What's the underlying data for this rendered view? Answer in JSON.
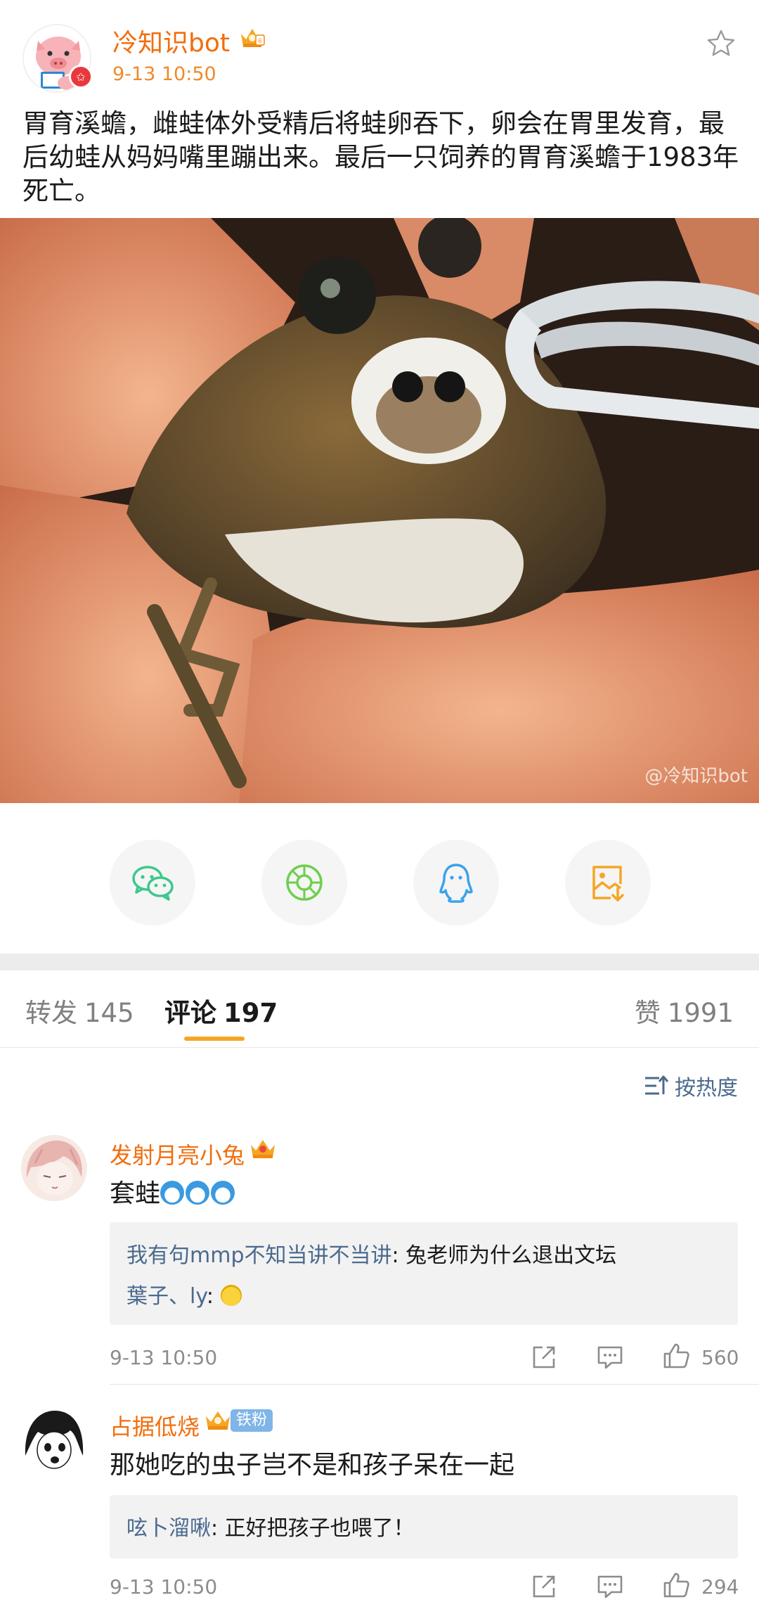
{
  "post": {
    "author": "冷知识bot",
    "time": "9-13 10:50",
    "text": "胃育溪蟾，雌蛙体外受精后将蛙卵吞下，卵会在胃里发育，最后幼蛙从妈妈嘴里蹦出来。最后一只饲养的胃育溪蟾于1983年死亡。",
    "photo_watermark": "@冷知识bot"
  },
  "share": [
    "wechat-icon",
    "moments-icon",
    "qq-icon",
    "save-image-icon"
  ],
  "tabs": {
    "repost_label": "转发",
    "repost_count": "145",
    "comment_label": "评论",
    "comment_count": "197",
    "like_label": "赞",
    "like_count": "1991"
  },
  "sort_label": "按热度",
  "comments": [
    {
      "name": "发射月亮小兔",
      "text": "套蛙",
      "emoji_count": 3,
      "replies": [
        {
          "user": "我有句mmp不知当讲不当讲",
          "text": ": 兔老师为什么退出文坛"
        },
        {
          "user": "葉子、ly",
          "text": ": "
        }
      ],
      "time": "9-13 10:50",
      "likes": "560"
    },
    {
      "name": "占据低烧",
      "fan_badge": "铁粉",
      "text": "那她吃的虫子岂不是和孩子呆在一起",
      "replies": [
        {
          "user": "呟卜溜啾",
          "text": ": 正好把孩子也喂了！"
        }
      ],
      "time": "9-13 10:50",
      "likes": "294"
    }
  ],
  "colors": {
    "orange": "#f26d0c",
    "link_blue": "#4b6a8e",
    "tab_underline": "#f5a623",
    "wechat_green": "#3cc88d",
    "moments_green": "#6fcf4c",
    "qq_blue": "#3aa3ec",
    "save_orange": "#f5a623"
  }
}
